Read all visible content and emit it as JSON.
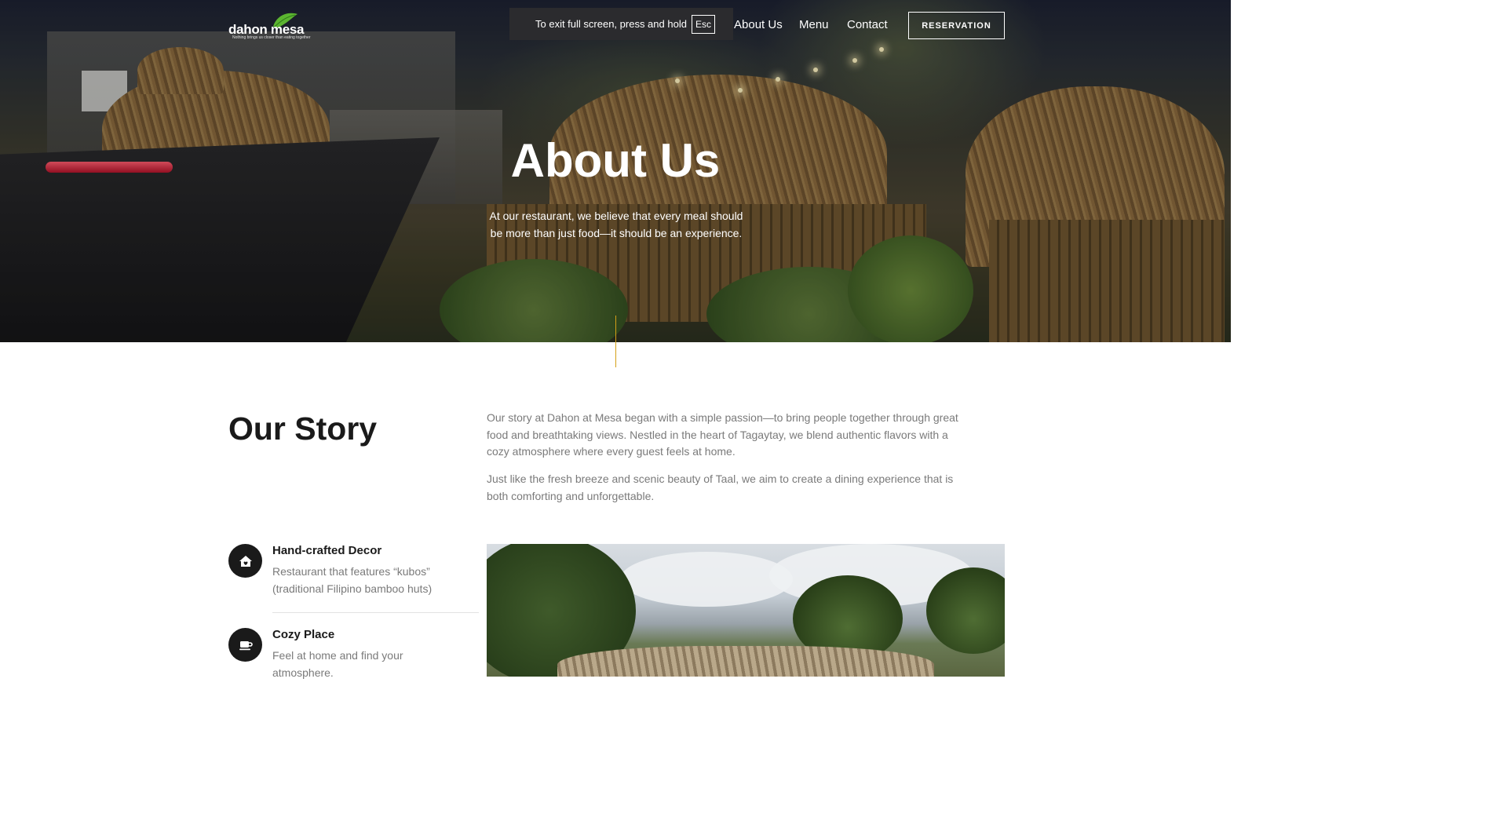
{
  "brand": {
    "name": "dahon mesa",
    "tagline": "Nothing brings us closer than eating together"
  },
  "fullscreen_notice": {
    "text": "To exit full screen, press and hold",
    "key": "Esc"
  },
  "nav": {
    "about": "About Us",
    "menu": "Menu",
    "contact": "Contact",
    "reservation": "RESERVATION"
  },
  "hero": {
    "title": "About Us",
    "subtitle": "At our restaurant, we believe that every meal should be more than just food—it should be an experience."
  },
  "story": {
    "title": "Our Story",
    "paragraphs": [
      "Our story at Dahon at Mesa began with a simple passion—to bring people together through great food and breathtaking views. Nestled in the heart of Tagaytay, we blend authentic flavors with a cozy atmosphere where every guest feels at home.",
      "Just like the fresh breeze and scenic beauty of Taal, we aim to create a dining experience that is both comforting and unforgettable."
    ]
  },
  "features": [
    {
      "icon": "home-heart-icon",
      "title": "Hand-crafted Decor",
      "description": "Restaurant that features “kubos” (traditional Filipino bamboo huts)"
    },
    {
      "icon": "coffee-cup-icon",
      "title": "Cozy Place",
      "description": "Feel at home and find your atmosphere."
    }
  ],
  "colors": {
    "accent": "#d4a017",
    "dark": "#1a1a1a",
    "muted_text": "#7a7a7a"
  }
}
